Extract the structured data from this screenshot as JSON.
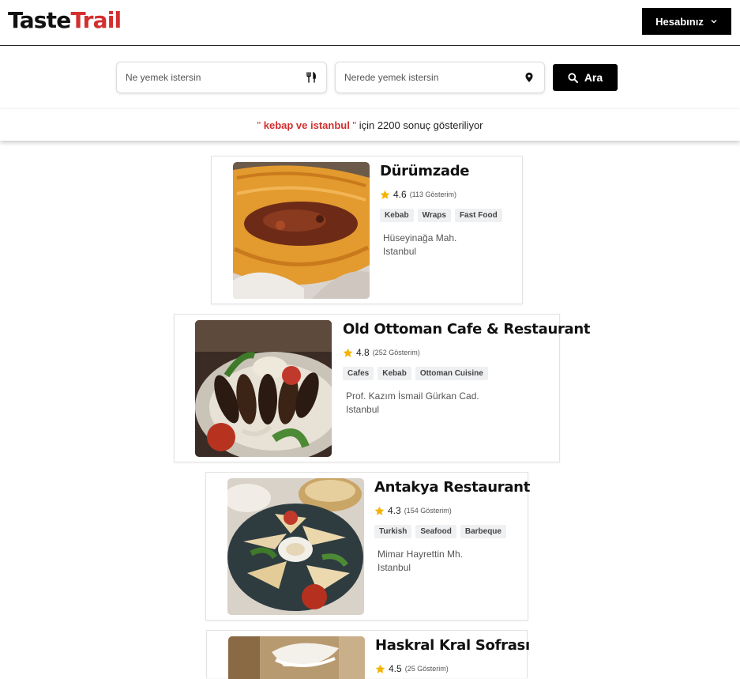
{
  "header": {
    "logo_part1": "Taste",
    "logo_part2": "Trail",
    "account_label": "Hesabınız"
  },
  "search": {
    "what_placeholder": "Ne yemek istersin",
    "where_placeholder": "Nerede yemek istersin",
    "button_label": "Ara"
  },
  "results": {
    "open_quote": "\"",
    "term": "kebap ve istanbul",
    "close_quote": "\"",
    "summary": "için 2200 sonuç gösteriliyor"
  },
  "restaurants": [
    {
      "name": "Dürümzade",
      "rating": "4.6",
      "views": "(113 Gösterim)",
      "tags": [
        "Kebab",
        "Wraps",
        "Fast Food"
      ],
      "address_line1": "Hüseyinağa Mah.",
      "address_line2": "Istanbul",
      "photo_icon": "wrap-photo"
    },
    {
      "name": "Old Ottoman Cafe & Restaurant",
      "rating": "4.8",
      "views": "(252 Gösterim)",
      "tags": [
        "Cafes",
        "Kebab",
        "Ottoman Cuisine"
      ],
      "address_line1": "Prof. Kazım İsmail Gürkan Cad.",
      "address_line2": "Istanbul",
      "photo_icon": "kebab-plate-photo"
    },
    {
      "name": "Antakya Restaurant",
      "rating": "4.3",
      "views": "(154 Gösterim)",
      "tags": [
        "Turkish",
        "Seafood",
        "Barbeque"
      ],
      "address_line1": "Mimar Hayrettin Mh.",
      "address_line2": "Istanbul",
      "photo_icon": "pide-plate-photo"
    },
    {
      "name": "Haskral Kral Sofrası",
      "rating": "4.5",
      "views": "(25 Gösterim)",
      "tags": [],
      "address_line1": "",
      "address_line2": "",
      "photo_icon": "restaurant-interior-photo"
    }
  ],
  "colors": {
    "brand_red": "#d32f2f",
    "star_yellow": "#f5b301",
    "button_black": "#000000"
  }
}
